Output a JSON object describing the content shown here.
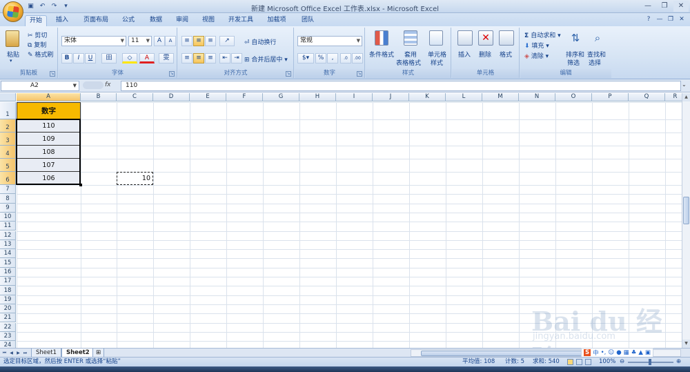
{
  "window": {
    "title": "新建 Microsoft Office Excel 工作表.xlsx - Microsoft Excel",
    "controls": {
      "minimize": "—",
      "restore": "❐",
      "close": "✕"
    }
  },
  "qat": {
    "save_icon": "save-icon",
    "undo_icon": "undo-icon",
    "redo_icon": "redo-icon",
    "customize_icon": "dropdown-icon"
  },
  "tabs": [
    "开始",
    "插入",
    "页面布局",
    "公式",
    "数据",
    "审阅",
    "视图",
    "开发工具",
    "加载项",
    "团队"
  ],
  "active_tab": "开始",
  "ribbon": {
    "clipboard": {
      "label": "剪贴板",
      "paste": "粘贴",
      "cut": "剪切",
      "copy": "复制",
      "format_painter": "格式刷"
    },
    "font": {
      "label": "字体",
      "font_name": "宋体",
      "font_size": "11",
      "grow": "A",
      "shrink": "A",
      "bold": "B",
      "italic": "I",
      "underline": "U",
      "border": "田",
      "fill": "◇",
      "color": "A",
      "phonetic": "雯"
    },
    "alignment": {
      "label": "对齐方式",
      "wrap": "自动换行",
      "merge": "合并后居中"
    },
    "number": {
      "label": "数字",
      "format": "常规",
      "percent": "%",
      "comma": ","
    },
    "styles": {
      "label": "样式",
      "conditional": "条件格式",
      "table_line1": "套用",
      "table_line2": "表格格式",
      "cell_line1": "单元格",
      "cell_line2": "样式"
    },
    "cells": {
      "label": "单元格",
      "insert": "插入",
      "delete": "删除",
      "format": "格式"
    },
    "editing": {
      "label": "编辑",
      "autosum": "自动求和",
      "fill": "填充",
      "clear": "清除",
      "sort_line1": "排序和",
      "sort_line2": "筛选",
      "find_line1": "查找和",
      "find_line2": "选择"
    }
  },
  "formula_bar": {
    "name_box": "A2",
    "fx": "fx",
    "value": "110"
  },
  "columns": [
    "A",
    "B",
    "C",
    "D",
    "E",
    "F",
    "G",
    "H",
    "I",
    "J",
    "K",
    "L",
    "M",
    "N",
    "O",
    "P",
    "Q",
    "R"
  ],
  "rows": [
    "1",
    "2",
    "3",
    "4",
    "5",
    "6",
    "7",
    "8",
    "9",
    "10",
    "11",
    "12",
    "13",
    "14",
    "15",
    "16",
    "17",
    "18",
    "19",
    "20",
    "21",
    "22",
    "23",
    "24"
  ],
  "cells": {
    "A1": "数字",
    "A2": "110",
    "A3": "109",
    "A4": "108",
    "A5": "107",
    "A6": "106",
    "C6": "10"
  },
  "sheets": [
    "Sheet1",
    "Sheet2"
  ],
  "active_sheet": "Sheet2",
  "status": {
    "message": "选定目标区域，然后按 ENTER 或选择“粘贴”",
    "average": "平均值: 108",
    "count": "计数: 5",
    "sum": "求和: 540",
    "zoom": "100%"
  },
  "ime": {
    "brand": "S",
    "mode": "中",
    "punct": "•,"
  },
  "watermark": {
    "line1": "Bai du 经验",
    "line2": "jingyan.baidu.com"
  },
  "colors": {
    "header_fill": "#f7b900",
    "selection_border": "#000000",
    "ribbon_bg": "#d6e4f4"
  }
}
